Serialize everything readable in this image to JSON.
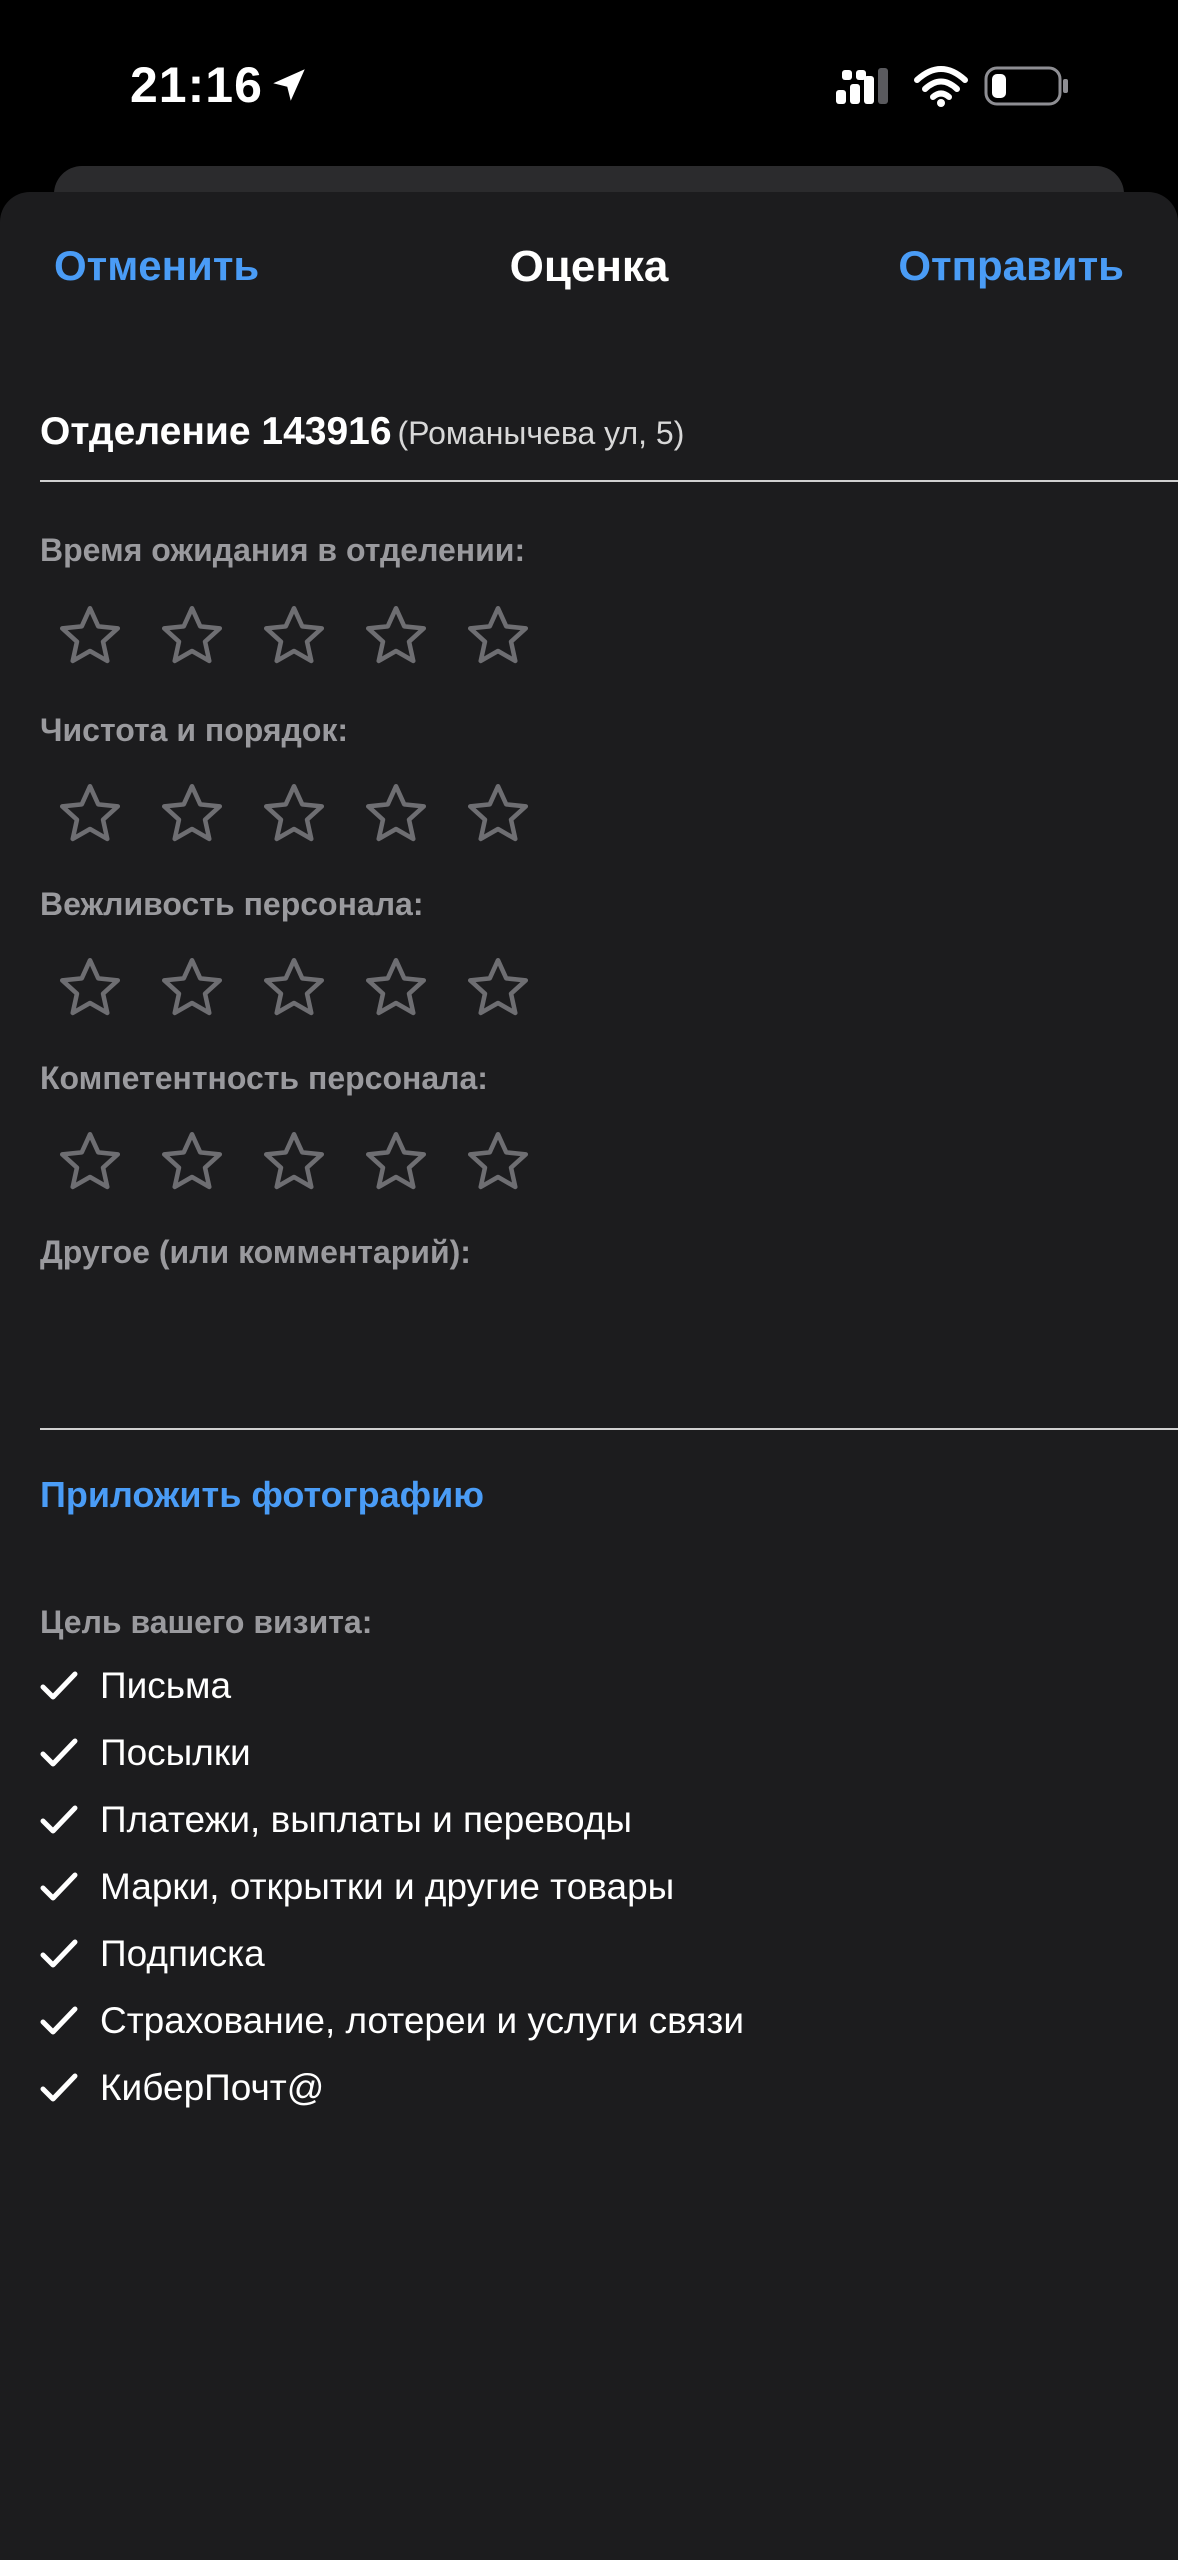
{
  "status_bar": {
    "time": "21:16",
    "icons": [
      "location-arrow-icon",
      "signal-icon",
      "wifi-icon",
      "battery-icon"
    ]
  },
  "nav": {
    "cancel_label": "Отменить",
    "title": "Оценка",
    "send_label": "Отправить"
  },
  "office": {
    "name": "Отделение 143916",
    "address": "(Романычева ул, 5)"
  },
  "ratings": [
    {
      "label": "Время ожидания в отделении:",
      "value": 0,
      "max": 5
    },
    {
      "label": "Чистота и порядок:",
      "value": 0,
      "max": 5
    },
    {
      "label": "Вежливость персонала:",
      "value": 0,
      "max": 5
    },
    {
      "label": "Компетентность персонала:",
      "value": 0,
      "max": 5
    }
  ],
  "comment": {
    "label": "Другое (или комментарий):",
    "value": ""
  },
  "attach_label": "Приложить фотографию",
  "purpose": {
    "label": "Цель вашего визита:",
    "items": [
      "Письма",
      "Посылки",
      "Платежи, выплаты и переводы",
      "Марки, открытки и другие товары",
      "Подписка",
      "Страхование, лотереи и услуги связи",
      "КиберПочт@"
    ]
  },
  "colors": {
    "accent": "#4a9cf6",
    "sheet_background": "#1c1c1e",
    "secondary_text": "#9a9a9e",
    "star_outline": "#6e6e72"
  }
}
